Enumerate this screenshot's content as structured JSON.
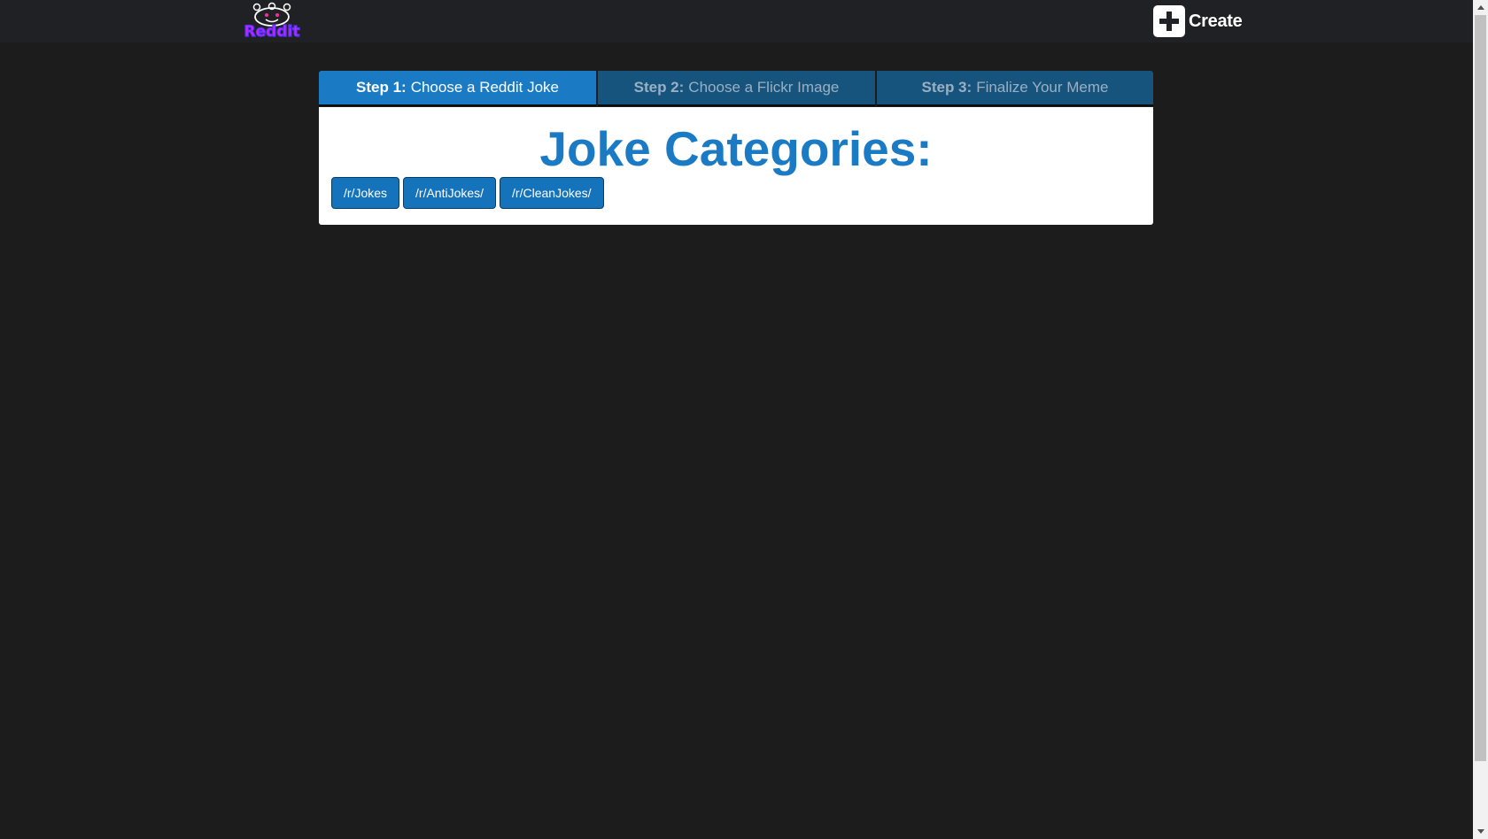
{
  "header": {
    "logo_text": "Reddit",
    "create_label": "Create"
  },
  "tabs": [
    {
      "step": "Step 1:",
      "label": "Choose a Reddit Joke",
      "active": true
    },
    {
      "step": "Step 2:",
      "label": "Choose a Flickr Image",
      "active": false
    },
    {
      "step": "Step 3:",
      "label": "Finalize Your Meme",
      "active": false
    }
  ],
  "panel": {
    "title": "Joke Categories:",
    "categories": [
      "/r/Jokes",
      "/r/AntiJokes/",
      "/r/CleanJokes/"
    ]
  },
  "icons": {
    "logo": "reddit-alien-logo",
    "create": "plus-square-icon"
  },
  "colors": {
    "background": "#1c1c1d",
    "navbar": "#202124",
    "accent": "#1a7bc4",
    "tab_inactive": "#16547e",
    "logo_text": "#cc22ff"
  }
}
